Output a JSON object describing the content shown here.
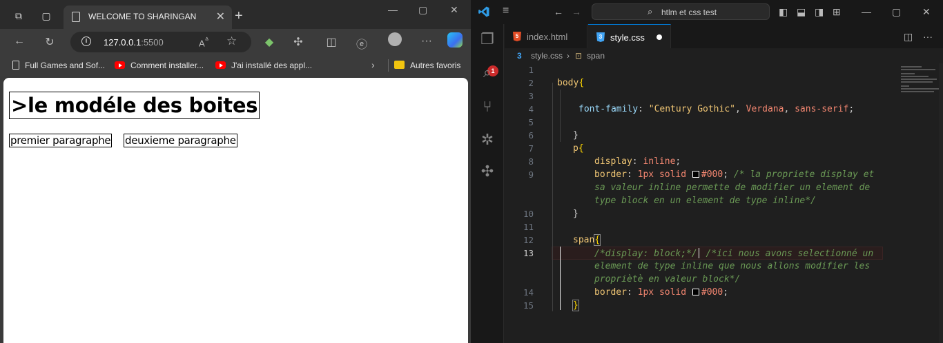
{
  "browser": {
    "tab_title": "WELCOME TO SHARINGAN",
    "url_host": "127.0.0.1",
    "url_port": ":5500",
    "bookmarks": [
      {
        "label": "Full Games and Sof...",
        "icon": "doc-icon"
      },
      {
        "label": "Comment installer...",
        "icon": "youtube-icon"
      },
      {
        "label": "J'ai installé des appl...",
        "icon": "youtube-icon"
      },
      {
        "label": "Autres favoris",
        "icon": "folder-icon"
      }
    ],
    "page": {
      "heading": ">le modéle des boites",
      "para1": "premier paragraphe",
      "para2": "deuxieme paragraphe"
    }
  },
  "vscode": {
    "search_text": "htlm et css test",
    "tabs": [
      {
        "label": "index.html",
        "icon": "html5-icon"
      },
      {
        "label": "style.css",
        "icon": "css3-icon",
        "modified": true
      }
    ],
    "breadcrumb": [
      "style.css",
      "span"
    ],
    "badge_count": "1",
    "line_numbers": [
      "1",
      "2",
      "3",
      "4",
      "5",
      "6",
      "7",
      "8",
      "9",
      "10",
      "11",
      "12",
      "13",
      "14",
      "15"
    ],
    "code": {
      "l2_sel": "body",
      "l4_prop": "font-family",
      "l4_str": "\"Century Gothic\"",
      "l4_v1": "Verdana",
      "l4_v2": "sans-serif",
      "l7_sel": "p",
      "l8_prop": "display",
      "l8_val": "inline",
      "l9_prop": "border",
      "l9_num": "1px",
      "l9_val": "solid",
      "l9_color": "#000",
      "l9_com1": "/* la propriete display et",
      "l9_com2": "sa valeur inline permette de modifier un element de",
      "l9_com3": "type block en un element de type inline*/",
      "l12_sel": "span",
      "l13_com_a": "/*display: block;*/",
      "l13_com_b": "/*ici nous avons selectionné un",
      "l13_com2": "element de type inline que nous allons modifier les",
      "l13_com3": "propriètè en valeur block*/",
      "l14_prop": "border",
      "l14_num": "1px",
      "l14_val": "solid",
      "l14_color": "#000"
    }
  },
  "colors": {
    "accent": "#0078d4",
    "badge": "#cc2b2b"
  }
}
